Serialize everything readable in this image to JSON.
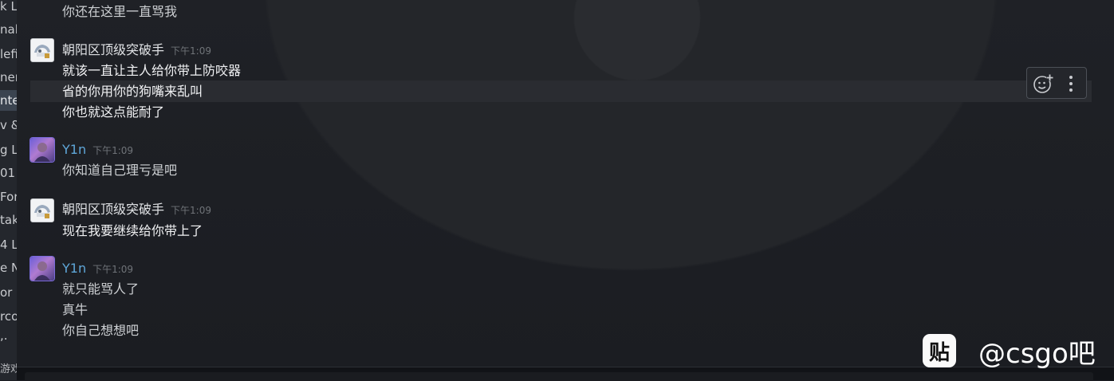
{
  "sidebar": {
    "items": [
      {
        "label": "k Lo"
      },
      {
        "label": "nalf"
      },
      {
        "label": "lefi"
      },
      {
        "label": "ner"
      },
      {
        "label": "nte"
      },
      {
        "label": "v &"
      },
      {
        "label": "g L"
      },
      {
        "label": "01"
      },
      {
        "label": "For"
      },
      {
        "label": "tak"
      },
      {
        "label": "4 L"
      },
      {
        "label": "e N"
      },
      {
        "label": "or 2"
      },
      {
        "label": "rco"
      },
      {
        "label": ",."
      }
    ],
    "footer": "游戏"
  },
  "messages": {
    "m0": {
      "lines": [
        "你还在这里一直骂我"
      ]
    },
    "m1": {
      "sender": "朝阳区顶级突破手",
      "time": "下午1:09",
      "lines": [
        "就该一直让主人给你带上防咬器",
        "省的你用你的狗嘴来乱叫",
        "你也就这点能耐了"
      ]
    },
    "m2": {
      "sender": "Y1n",
      "time": "下午1:09",
      "lines": [
        "你知道自己理亏是吧"
      ]
    },
    "m3": {
      "sender": "朝阳区顶级突破手",
      "time": "下午1:09",
      "lines": [
        "现在我要继续给你带上了"
      ]
    },
    "m4": {
      "sender": "Y1n",
      "time": "下午1:09",
      "lines": [
        "就只能骂人了",
        "真牛",
        "你自己想想吧"
      ]
    }
  },
  "actions": {
    "react_icon": "add-reaction-icon",
    "more_icon": "more-vertical-icon"
  },
  "watermark": {
    "logo_text": "贴",
    "text": "@csgo吧"
  },
  "colors": {
    "background": "#1c1e23",
    "name_highlight": "#5fa7d9",
    "hover_row": "#2a2c31"
  }
}
